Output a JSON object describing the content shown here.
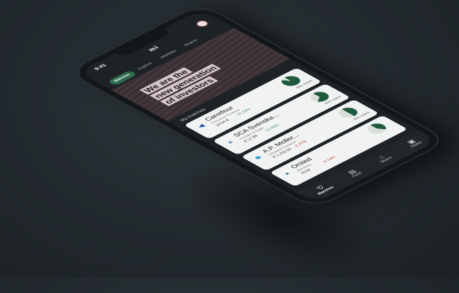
{
  "status": {
    "time": "9:41"
  },
  "app": {
    "brand": "mi"
  },
  "tabs": [
    {
      "label": "Matches"
    },
    {
      "label": "Explore"
    },
    {
      "label": "Watchlist"
    },
    {
      "label": "Search"
    }
  ],
  "hero": {
    "lines": [
      "We are the",
      "new generation",
      "of investors"
    ]
  },
  "section_title": "My matches",
  "cards": [
    {
      "name": "Carrefour",
      "sub": "Consumer Products",
      "price": "19.54 €",
      "change": "+0.19%",
      "change_dir": "up",
      "logo_icon": "carrefour-logo",
      "logo_color": "#1e50a0",
      "match": "90% match",
      "match_value": 90
    },
    {
      "name": "SCA Svenska...",
      "sub": "Forestry & Paper",
      "price": "€ 17.68",
      "change": "+2.45%",
      "change_dir": "up",
      "logo_icon": "sca-logo",
      "logo_color": "#4a8a9a",
      "match": "65% match",
      "match_value": 65
    },
    {
      "name": "A.P. Moller...",
      "sub": "Industrial Transport",
      "price": "€ 1,755.50",
      "change": "-2.47%",
      "change_dir": "down",
      "logo_icon": "maersk-star-logo",
      "logo_color": "#2b8fc9",
      "match": "50% match",
      "match_value": 50
    },
    {
      "name": "Orsted",
      "sub": "Electricity",
      "price": "€118",
      "change": "-0.14%",
      "change_dir": "down",
      "logo_icon": "orsted-logo",
      "logo_color": "#2a70b8",
      "match": "",
      "match_value": 40
    }
  ],
  "nav": [
    {
      "label": "Matches",
      "icon": "heart-icon",
      "glyph": "♡",
      "active": true
    },
    {
      "label": "Feed",
      "icon": "feed-icon",
      "glyph": "▤",
      "active": false
    },
    {
      "label": "Stores",
      "icon": "store-icon",
      "glyph": "⌂",
      "active": false
    },
    {
      "label": "Wallet",
      "icon": "wallet-icon",
      "glyph": "▣",
      "active": false
    }
  ],
  "colors": {
    "accent": "#2f6b4e",
    "background": "#242b30",
    "hero_text_bg": "#d7c7cb"
  }
}
